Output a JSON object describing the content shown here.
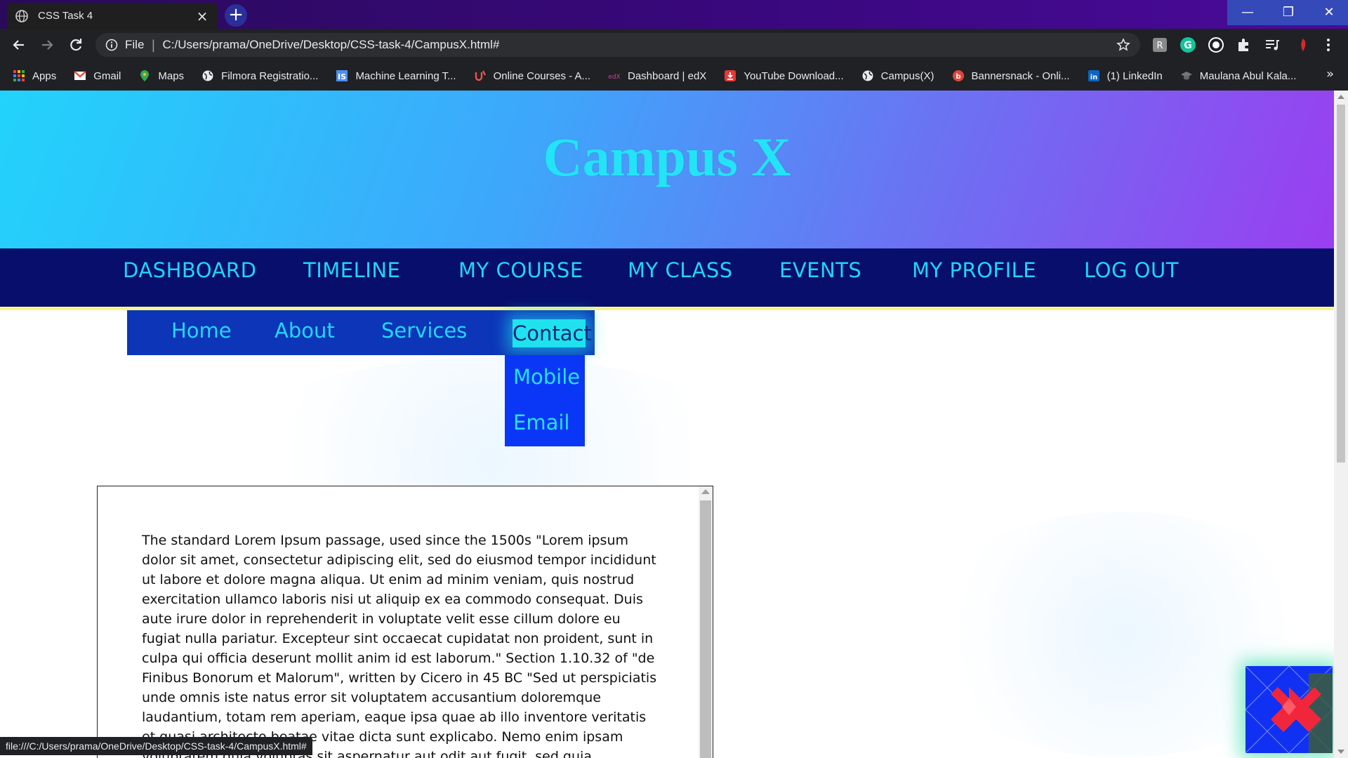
{
  "browser": {
    "tab_title": "CSS Task 4",
    "url_scheme": "File",
    "url": "C:/Users/prama/OneDrive/Desktop/CSS-task-4/CampusX.html#",
    "bookmarks": [
      {
        "label": "Apps",
        "icon": "apps-grid-icon"
      },
      {
        "label": "Gmail",
        "icon": "gmail-icon"
      },
      {
        "label": "Maps",
        "icon": "maps-pin-icon"
      },
      {
        "label": "Filmora Registratio...",
        "icon": "globe-icon"
      },
      {
        "label": "Machine Learning T...",
        "icon": "is-logo-icon"
      },
      {
        "label": "Online Courses - A...",
        "icon": "udemy-icon"
      },
      {
        "label": "Dashboard | edX",
        "icon": "edx-icon"
      },
      {
        "label": "YouTube Download...",
        "icon": "download-icon"
      },
      {
        "label": "Campus(X)",
        "icon": "globe-icon"
      },
      {
        "label": "Bannersnack - Onli...",
        "icon": "bannersnack-icon"
      },
      {
        "label": "(1) LinkedIn",
        "icon": "linkedin-icon"
      },
      {
        "label": "Maulana Abul Kala...",
        "icon": "graduation-cap-icon"
      }
    ],
    "status_text": "file:///C:/Users/prama/OneDrive/Desktop/CSS-task-4/CampusX.html#"
  },
  "page": {
    "title": "Campus X",
    "main_nav": [
      "DASHBOARD",
      "TIMELINE",
      "MY COURSE",
      "MY CLASS",
      "EVENTS",
      "MY PROFILE",
      "LOG OUT"
    ],
    "sub_nav": [
      "Home",
      "About",
      "Services",
      "Contact"
    ],
    "dropdown": [
      "Mobile",
      "Email"
    ],
    "body_text": "The standard Lorem Ipsum passage, used since the 1500s \"Lorem ipsum dolor sit amet, consectetur adipiscing elit, sed do eiusmod tempor incididunt ut labore et dolore magna aliqua. Ut enim ad minim veniam, quis nostrud exercitation ullamco laboris nisi ut aliquip ex ea commodo consequat. Duis aute irure dolor in reprehenderit in voluptate velit esse cillum dolore eu fugiat nulla pariatur. Excepteur sint occaecat cupidatat non proident, sunt in culpa qui officia deserunt mollit anim id est laborum.\" Section 1.10.32 of \"de Finibus Bonorum et Malorum\", written by Cicero in 45 BC \"Sed ut perspiciatis unde omnis iste natus error sit voluptatem accusantium doloremque laudantium, totam rem aperiam, eaque ipsa quae ab illo inventore veritatis et quasi architecto beatae vitae dicta sunt explicabo. Nemo enim ipsam voluptatem quia voluptas sit aspernatur aut odit aut fugit, sed quia consequuntur magni"
  },
  "colors": {
    "hero_gradient_start": "#22d3fb",
    "hero_gradient_end": "#9a3ef0",
    "title_color": "#22e4f6",
    "nav_bg": "#080e6b",
    "nav_text": "#1fd6f4",
    "subnav_bg": "#0c35b8",
    "contact_highlight": "#20e2ee",
    "dropdown_bg": "#0a37f5"
  }
}
